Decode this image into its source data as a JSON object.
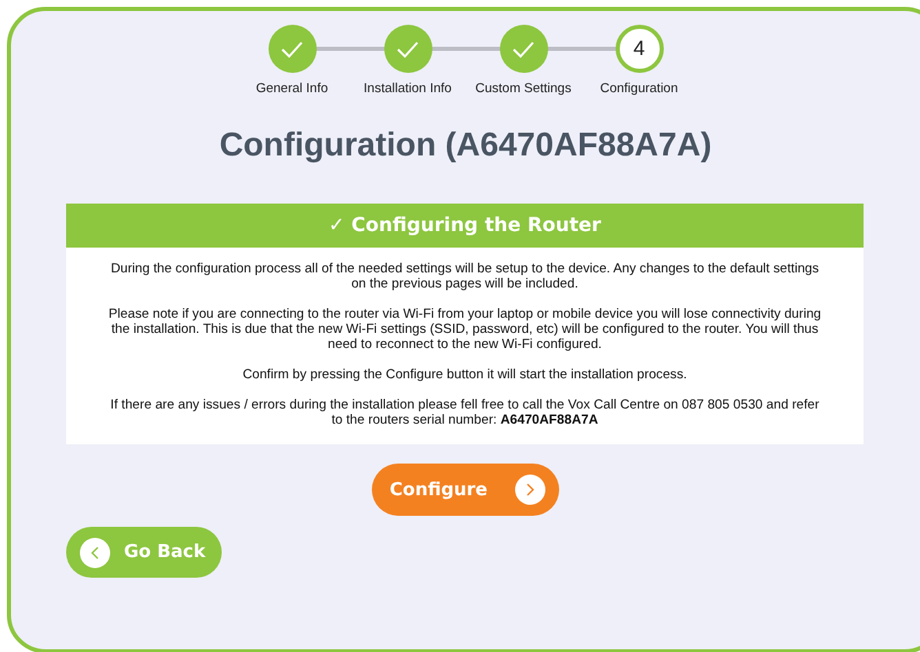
{
  "steps": [
    {
      "label": "General Info",
      "completed": true
    },
    {
      "label": "Installation Info",
      "completed": true
    },
    {
      "label": "Custom Settings",
      "completed": true
    },
    {
      "label": "Configuration",
      "completed": false,
      "number": "4"
    }
  ],
  "title": "Configuration (A6470AF88A7A)",
  "panel": {
    "heading": "✓ Configuring the Router",
    "paragraphs": [
      "During the configuration process all of the needed settings will be setup to the device. Any changes to the default settings on the previous pages will be included.",
      "Please note if you are connecting to the router via Wi-Fi from your laptop or mobile device you will lose connectivity during the installation. This is due that the new Wi-Fi settings (SSID, password, etc) will be configured to the router. You will thus need to reconnect to the new Wi-Fi configured.",
      "Confirm by pressing the Configure button it will start the installation process.",
      "If there are any issues / errors during the installation please fell free to call the Vox Call Centre on 087 805 0530 and refer to the routers serial number: **A6470AF88A7A**"
    ]
  },
  "configure_button": "Configure",
  "back_button": "Go Back"
}
